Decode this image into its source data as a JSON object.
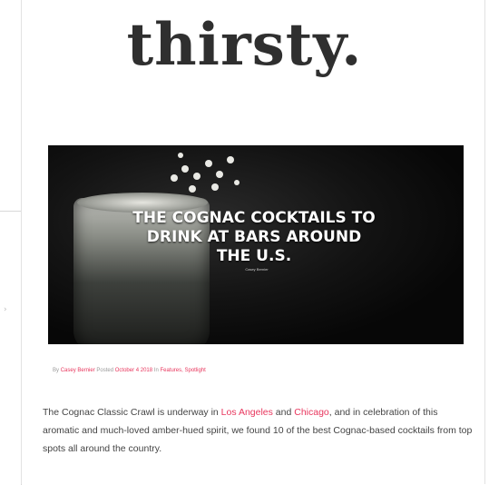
{
  "site": {
    "logo": "thirsty."
  },
  "article": {
    "title": "THE COGNAC COCKTAILS TO DRINK AT BARS AROUND THE U.S.",
    "byline": {
      "by": "By",
      "author": "Casey Bernier",
      "posted": "Posted",
      "date": "October 4 2018",
      "in": "In",
      "category": "Features, Spotlight"
    },
    "intro": {
      "part1": "The Cognac Classic Crawl is underway in ",
      "link1": "Los Angeles",
      "and": " and ",
      "link2": "Chicago",
      "part2": ", and in celebration of this aromatic and much-loved amber-hued spirit, we found 10 of the best Cognac-based cocktails from top spots all around the country."
    }
  }
}
